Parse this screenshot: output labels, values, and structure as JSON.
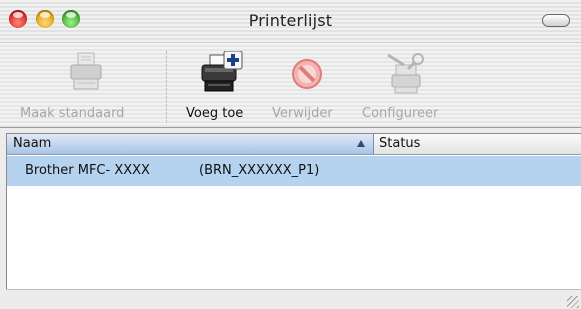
{
  "window": {
    "title": "Printerlijst"
  },
  "toolbar": {
    "items": [
      {
        "label": "Maak standaard",
        "icon": "printer-icon",
        "enabled": false
      },
      {
        "label": "Voeg toe",
        "icon": "add-printer-icon",
        "enabled": true
      },
      {
        "label": "Verwijder",
        "icon": "delete-icon",
        "enabled": false
      },
      {
        "label": "Configureer",
        "icon": "configure-tools-icon",
        "enabled": false
      }
    ]
  },
  "table": {
    "columns": [
      {
        "label": "Naam",
        "sorted": "ascending"
      },
      {
        "label": "Status"
      }
    ],
    "rows": [
      {
        "name": "Brother MFC- XXXX",
        "id": "(BRN_XXXXXX_P1)",
        "status": "",
        "selected": true
      }
    ]
  },
  "colors": {
    "close": "#d9231a",
    "minimize": "#e0a10c",
    "zoom": "#3cab2a",
    "selection": "#b5d3ef",
    "header": "#a9c3e6"
  }
}
